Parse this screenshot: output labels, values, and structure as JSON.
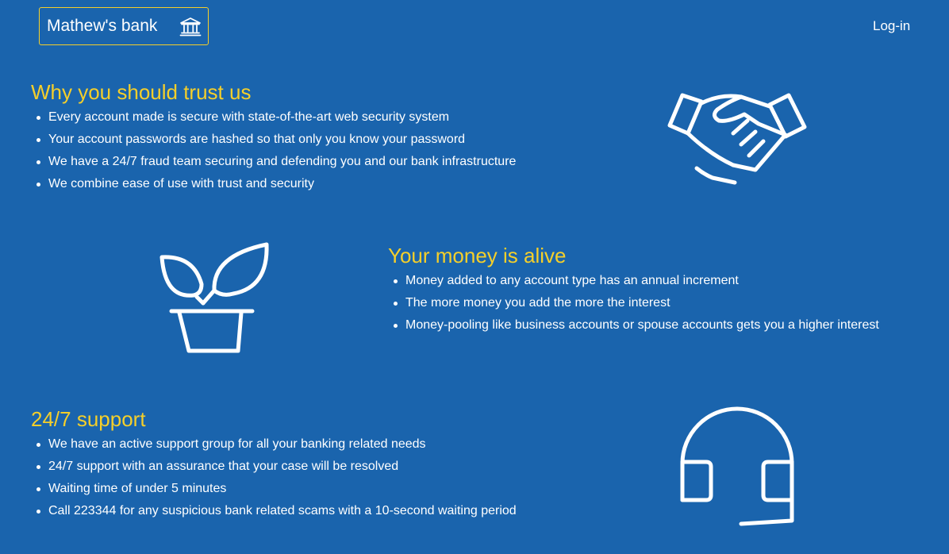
{
  "header": {
    "brand_name": "Mathew's bank",
    "brand_icon": "bank-icon",
    "login_label": "Log-in"
  },
  "colors": {
    "background": "#1a64ad",
    "accent": "#f5cf2a",
    "text": "#ffffff"
  },
  "sections": [
    {
      "title": "Why you should trust us",
      "icon": "handshake-icon",
      "points": [
        "Every account made is secure with state-of-the-art web security system",
        "Your account passwords are hashed so that only you know your password",
        "We have a 24/7 fraud team securing and defending you and our bank infrastructure",
        "We combine ease of use with trust and security"
      ]
    },
    {
      "title": "Your money is alive",
      "icon": "plant-pot-icon",
      "points": [
        "Money added to any account type has an annual increment",
        "The more money you add the more the interest",
        "Money-pooling like business accounts or spouse accounts gets you a higher interest"
      ]
    },
    {
      "title": "24/7 support",
      "icon": "headset-icon",
      "points": [
        "We have an active support group for all your banking related needs",
        "24/7 support with an assurance that your case will be resolved",
        "Waiting time of under 5 minutes",
        "Call 223344 for any suspicious bank related scams with a 10-second waiting period"
      ]
    }
  ]
}
